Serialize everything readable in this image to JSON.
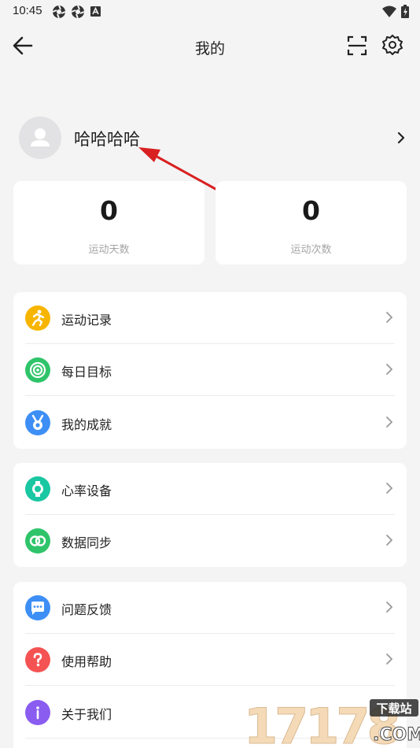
{
  "status_bar": {
    "time": "10:45"
  },
  "header": {
    "title": "我的"
  },
  "profile": {
    "name": "哈哈哈哈"
  },
  "stats": [
    {
      "value": "0",
      "label": "运动天数"
    },
    {
      "value": "0",
      "label": "运动次数"
    }
  ],
  "menu_groups": [
    {
      "items": [
        {
          "label": "运动记录",
          "icon": "running-icon",
          "color": "#f7b500"
        },
        {
          "label": "每日目标",
          "icon": "target-icon",
          "color": "#2fc46a"
        },
        {
          "label": "我的成就",
          "icon": "medal-icon",
          "color": "#3d8ff5"
        }
      ]
    },
    {
      "items": [
        {
          "label": "心率设备",
          "icon": "watch-icon",
          "color": "#19c7a2"
        },
        {
          "label": "数据同步",
          "icon": "sync-icon",
          "color": "#2fc46a"
        }
      ]
    },
    {
      "items": [
        {
          "label": "问题反馈",
          "icon": "chat-icon",
          "color": "#3d8ff5"
        },
        {
          "label": "使用帮助",
          "icon": "help-icon",
          "color": "#f55353"
        },
        {
          "label": "关于我们",
          "icon": "info-icon",
          "color": "#8a5cf0"
        }
      ]
    }
  ],
  "watermark": {
    "number": "17178",
    "site": "下载站",
    "domain": ".COM"
  }
}
